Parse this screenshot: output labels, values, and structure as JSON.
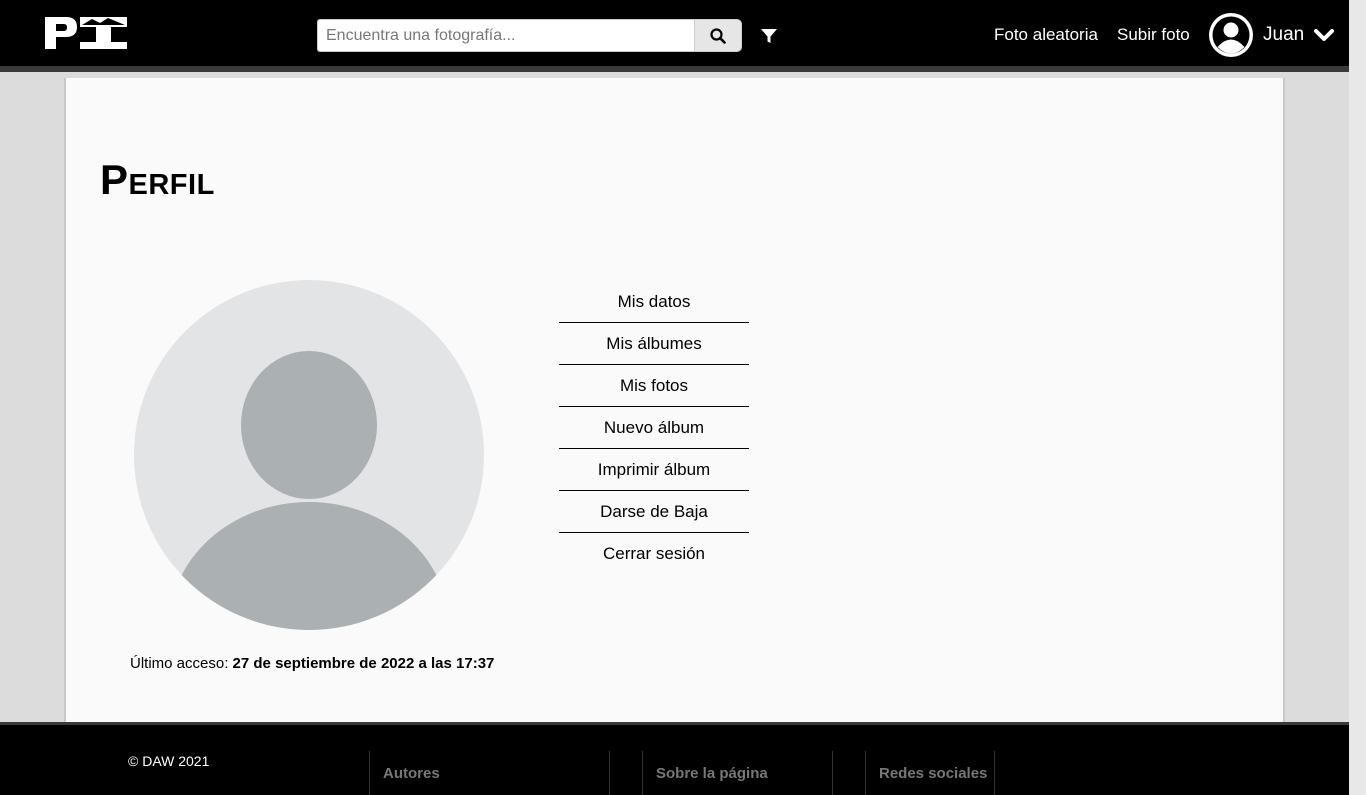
{
  "header": {
    "search_placeholder": "Encuentra una fotografía...",
    "links": {
      "random_photo": "Foto aleatoria",
      "upload_photo": "Subir foto"
    },
    "user_name": "Juan"
  },
  "main": {
    "title": "Perfil",
    "menu": [
      "Mis datos",
      "Mis álbumes",
      "Mis fotos",
      "Nuevo álbum",
      "Imprimir álbum",
      "Darse de Baja",
      "Cerrar sesión"
    ],
    "last_access_label": "Último acceso:",
    "last_access_value": "27 de septiembre de 2022 a las 17:37"
  },
  "footer": {
    "copyright": "© DAW 2021",
    "columns": [
      "Autores",
      "Sobre la página",
      "Redes sociales"
    ]
  },
  "colors": {
    "header_bg": "#000000",
    "page_bg": "#dcdcdc",
    "content_bg": "#fafafa",
    "avatar_bg": "#e3e4e6",
    "avatar_fg": "#abb0b3"
  }
}
